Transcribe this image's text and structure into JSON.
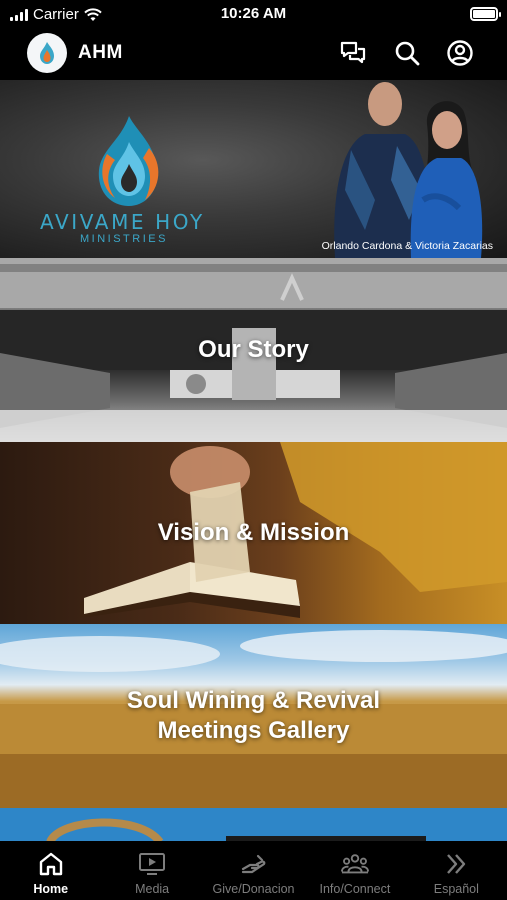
{
  "status_bar": {
    "carrier": "Carrier",
    "time": "10:26 AM"
  },
  "header": {
    "title": "AHM",
    "icons": [
      "chat-icon",
      "search-icon",
      "account-icon"
    ]
  },
  "banner": {
    "logo_name": "AVIVAME HOY",
    "logo_subtitle": "MINISTRIES",
    "caption": "Orlando Cardona & Victoria Zacarias"
  },
  "tiles": [
    {
      "label": "Our Story"
    },
    {
      "label": "Vision & Mission"
    },
    {
      "label_line1": "Soul Wining & Revival",
      "label_line2": "Meetings Gallery"
    }
  ],
  "tab_bar": {
    "items": [
      {
        "label": "Home",
        "icon": "home-icon",
        "active": true
      },
      {
        "label": "Media",
        "icon": "media-icon",
        "active": false
      },
      {
        "label": "Give/Donacion",
        "icon": "give-icon",
        "active": false
      },
      {
        "label": "Info/Connect",
        "icon": "people-icon",
        "active": false
      },
      {
        "label": "Español",
        "icon": "chevrons-right-icon",
        "active": false
      }
    ]
  },
  "colors": {
    "background": "#000000",
    "brand_blue": "#3ba7c8",
    "brand_orange": "#e8762b",
    "tab_inactive": "#7d7d7d",
    "tab_active": "#ffffff"
  }
}
